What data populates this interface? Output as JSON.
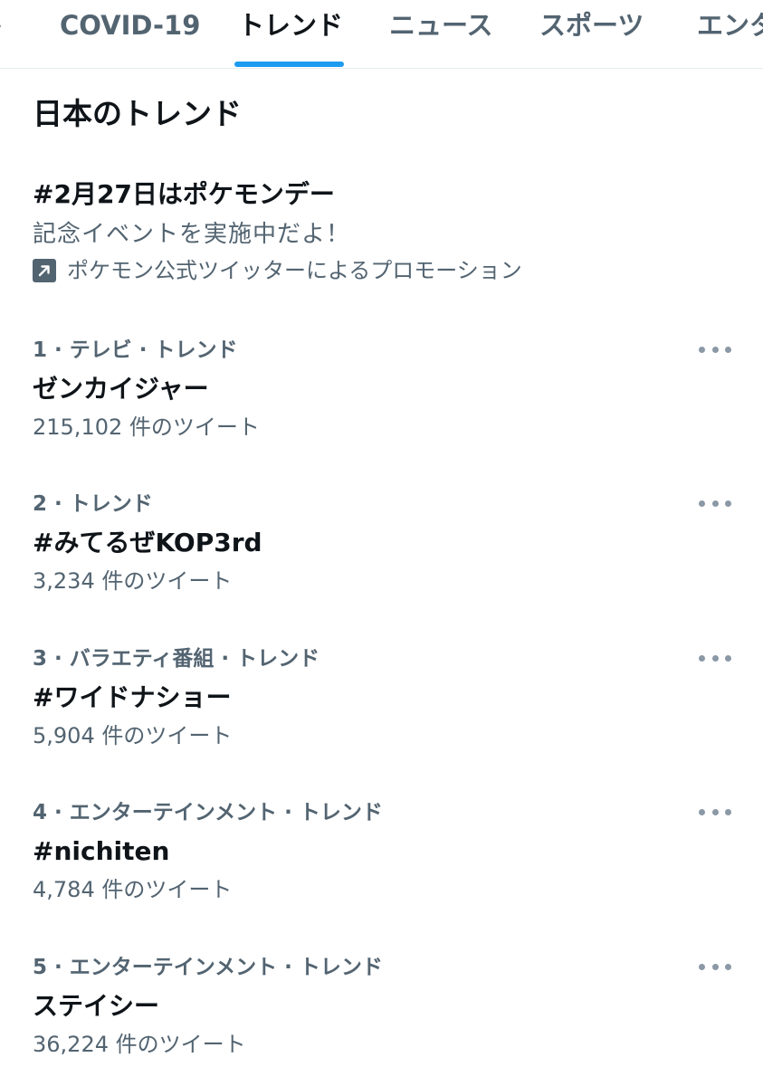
{
  "tabs": [
    {
      "label": "COVID-19"
    },
    {
      "label": "トレンド"
    },
    {
      "label": "ニュース"
    },
    {
      "label": "スポーツ"
    },
    {
      "label": "エンタ"
    }
  ],
  "section_title": "日本のトレンド",
  "promoted": {
    "title": "#2月27日はポケモンデー",
    "description": "記念イベントを実施中だよ！",
    "promoted_by": "ポケモン公式ツイッターによるプロモーション"
  },
  "trends": [
    {
      "meta": "1 · テレビ · トレンド",
      "name": "ゼンカイジャー",
      "count": "215,102 件のツイート"
    },
    {
      "meta": "2 · トレンド",
      "name": "#みてるぜKOP3rd",
      "count": "3,234 件のツイート"
    },
    {
      "meta": "3 · バラエティ番組 · トレンド",
      "name": "#ワイドナショー",
      "count": "5,904 件のツイート"
    },
    {
      "meta": "4 · エンターテインメント · トレンド",
      "name": "#nichiten",
      "count": "4,784 件のツイート"
    },
    {
      "meta": "5 · エンターテインメント · トレンド",
      "name": "ステイシー",
      "count": "36,224 件のツイート"
    }
  ],
  "icons": {
    "promoted": "promoted-arrow-icon",
    "more": "more-options-icon"
  },
  "colors": {
    "accent": "#1d9bf0",
    "text_primary": "#0f1419",
    "text_secondary": "#536471"
  }
}
